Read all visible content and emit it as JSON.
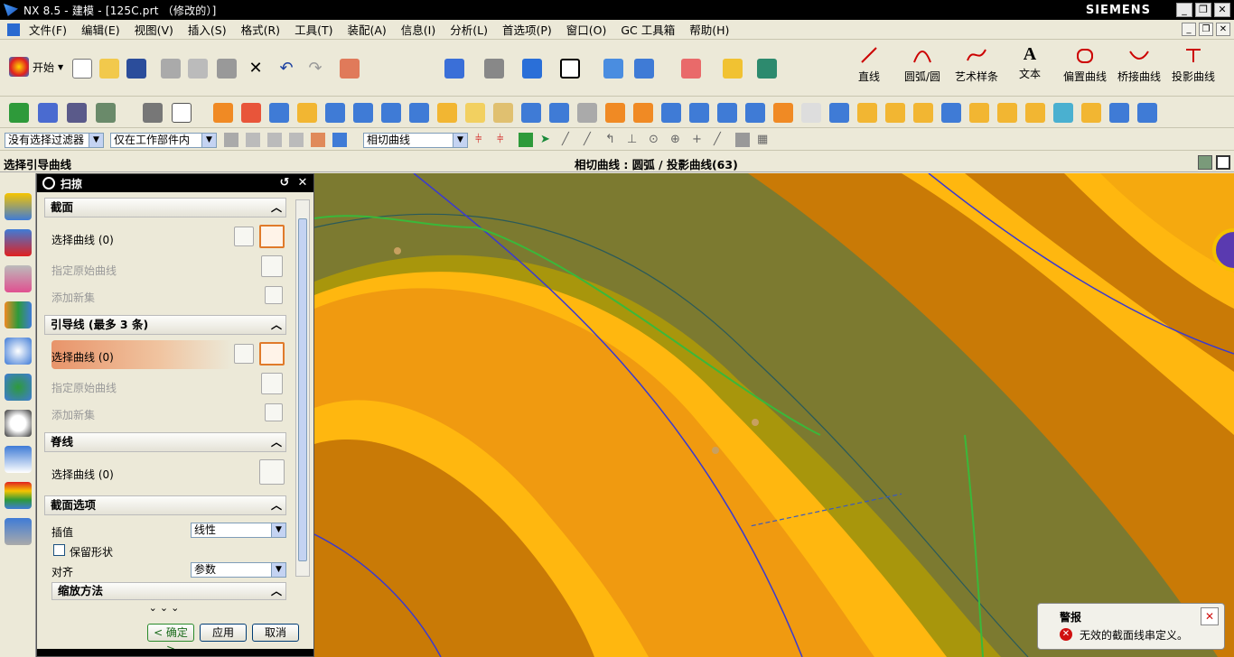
{
  "window": {
    "title": "NX 8.5 - 建模 - [125C.prt （修改的）]",
    "brand": "SIEMENS",
    "min": "_",
    "restore": "❐",
    "close": "✕"
  },
  "menu": [
    "文件(F)",
    "编辑(E)",
    "视图(V)",
    "插入(S)",
    "格式(R)",
    "工具(T)",
    "装配(A)",
    "信息(I)",
    "分析(L)",
    "首选项(P)",
    "窗口(O)",
    "GC 工具箱",
    "帮助(H)"
  ],
  "toolbar": {
    "start_label": "开始",
    "curve_tools": [
      "直线",
      "圆弧/圆",
      "艺术样条",
      "文本",
      "偏置曲线",
      "桥接曲线",
      "投影曲线"
    ]
  },
  "selection_bar": {
    "filter": "没有选择过滤器",
    "scope": "仅在工作部件内",
    "curve_rule": "相切曲线"
  },
  "status": {
    "prompt": "选择引导曲线",
    "info": "相切曲线 : 圆弧 / 投影曲线(63)"
  },
  "dialog": {
    "title": "扫掠",
    "sections": {
      "section": {
        "title": "截面",
        "select": "选择曲线 (0)",
        "specify": "指定原始曲线",
        "add": "添加新集"
      },
      "guide": {
        "title": "引导线 (最多 3 条)",
        "select": "选择曲线 (0)",
        "specify": "指定原始曲线",
        "add": "添加新集"
      },
      "spine": {
        "title": "脊线",
        "select": "选择曲线 (0)"
      },
      "options": {
        "title": "截面选项",
        "interp_label": "插值",
        "interp_value": "线性",
        "keep_shape": "保留形状",
        "align_label": "对齐",
        "align_value": "参数",
        "scaling": "缩放方法"
      }
    },
    "buttons": {
      "ok": "< 确定 >",
      "apply": "应用",
      "cancel": "取消"
    }
  },
  "alert": {
    "title": "警报",
    "message": "无效的截面线串定义。"
  }
}
